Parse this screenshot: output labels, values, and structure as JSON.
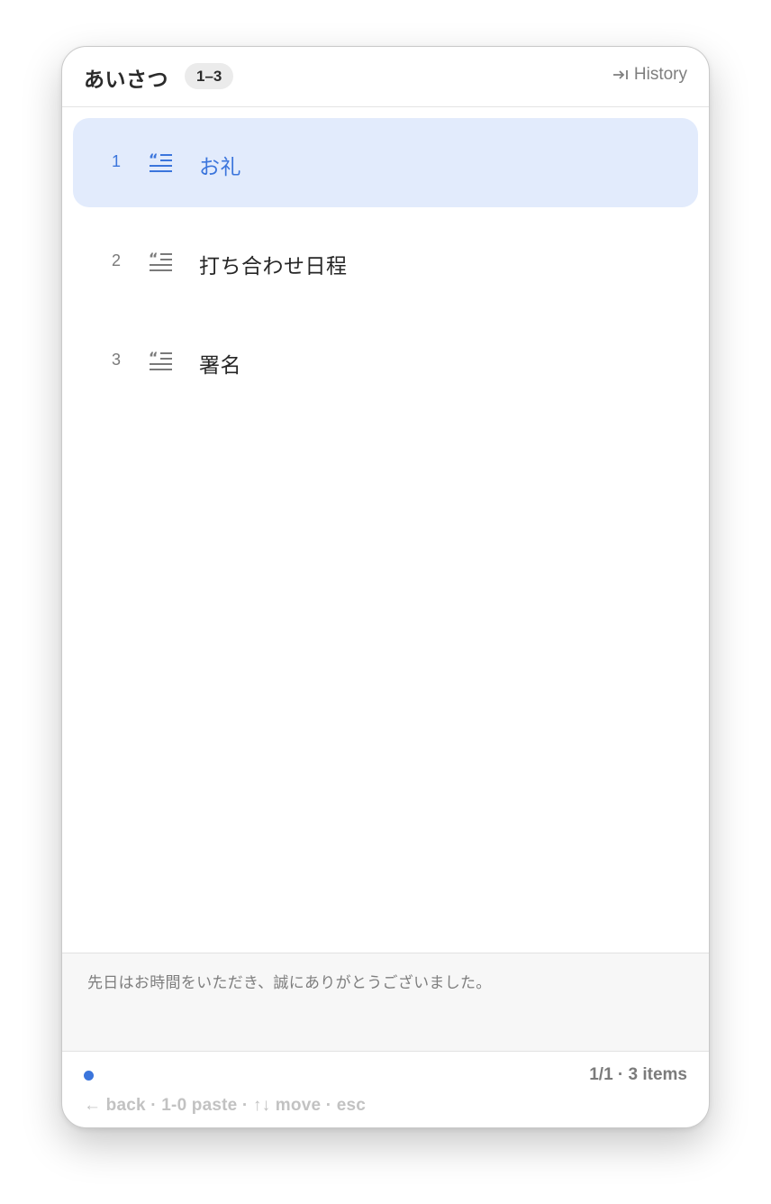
{
  "header": {
    "title": "あいさつ",
    "badge": "1–3",
    "history_label": "History",
    "history_icon": "arrow-to-right-icon"
  },
  "items": [
    {
      "number": "1",
      "icon": "quote-text-icon",
      "label": "お礼",
      "selected": true
    },
    {
      "number": "2",
      "icon": "quote-text-icon",
      "label": "打ち合わせ日程",
      "selected": false
    },
    {
      "number": "3",
      "icon": "quote-text-icon",
      "label": "署名",
      "selected": false
    }
  ],
  "preview": {
    "text": "先日はお時間をいただき、誠にありがとうございました。"
  },
  "footer": {
    "status_color": "#3b75dc",
    "count": "1/1 · 3 items",
    "hints": "← back · 1-0 paste · ↑↓ move · esc"
  },
  "colors": {
    "accent": "#3b75dc",
    "selected_bg": "#e2ebfc"
  }
}
